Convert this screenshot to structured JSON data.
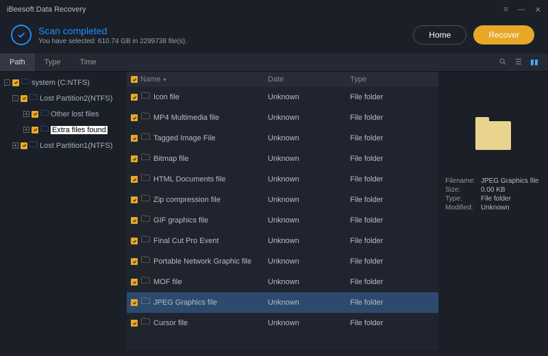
{
  "app_title": "iBeesoft Data Recovery",
  "scan": {
    "title": "Scan completed",
    "subtitle": "You have selected: 610.74 GB in 2299738 file(s)."
  },
  "buttons": {
    "home": "Home",
    "recover": "Recover"
  },
  "tabs": [
    "Path",
    "Type",
    "Time"
  ],
  "active_tab": 0,
  "tree": [
    {
      "depth": 0,
      "expander": "-",
      "label": "system (C:NTFS)",
      "selected": false
    },
    {
      "depth": 1,
      "expander": "-",
      "label": "Lost Partition2(NTFS)",
      "selected": false
    },
    {
      "depth": 2,
      "expander": "+",
      "label": "Other lost files",
      "selected": false
    },
    {
      "depth": 2,
      "expander": "+",
      "label": "Extra files found",
      "selected": true
    },
    {
      "depth": 1,
      "expander": "+",
      "label": "Lost Partition1(NTFS)",
      "selected": false
    }
  ],
  "columns": {
    "name": "Name",
    "date": "Date",
    "type": "Type"
  },
  "files": [
    {
      "name": "Icon file",
      "date": "Unknown",
      "type": "File folder"
    },
    {
      "name": "MP4 Multimedia file",
      "date": "Unknown",
      "type": "File folder"
    },
    {
      "name": "Tagged Image File",
      "date": "Unknown",
      "type": "File folder"
    },
    {
      "name": "Bitmap file",
      "date": "Unknown",
      "type": "File folder"
    },
    {
      "name": "HTML Documents file",
      "date": "Unknown",
      "type": "File folder"
    },
    {
      "name": "Zip compression file",
      "date": "Unknown",
      "type": "File folder"
    },
    {
      "name": "GIF graphics file",
      "date": "Unknown",
      "type": "File folder"
    },
    {
      "name": "Final Cut Pro Event",
      "date": "Unknown",
      "type": "File folder"
    },
    {
      "name": "Portable Network Graphic file",
      "date": "Unknown",
      "type": "File folder"
    },
    {
      "name": "MOF file",
      "date": "Unknown",
      "type": "File folder"
    },
    {
      "name": "JPEG Graphics file",
      "date": "Unknown",
      "type": "File folder"
    },
    {
      "name": "Cursor file",
      "date": "Unknown",
      "type": "File folder"
    }
  ],
  "selected_file_index": 10,
  "details": {
    "labels": {
      "filename": "Filename:",
      "size": "Size:",
      "type": "Type:",
      "modified": "Modified:"
    },
    "filename": "JPEG Graphics file",
    "size": "0.00 KB",
    "type": "File folder",
    "modified": "Unknown"
  }
}
